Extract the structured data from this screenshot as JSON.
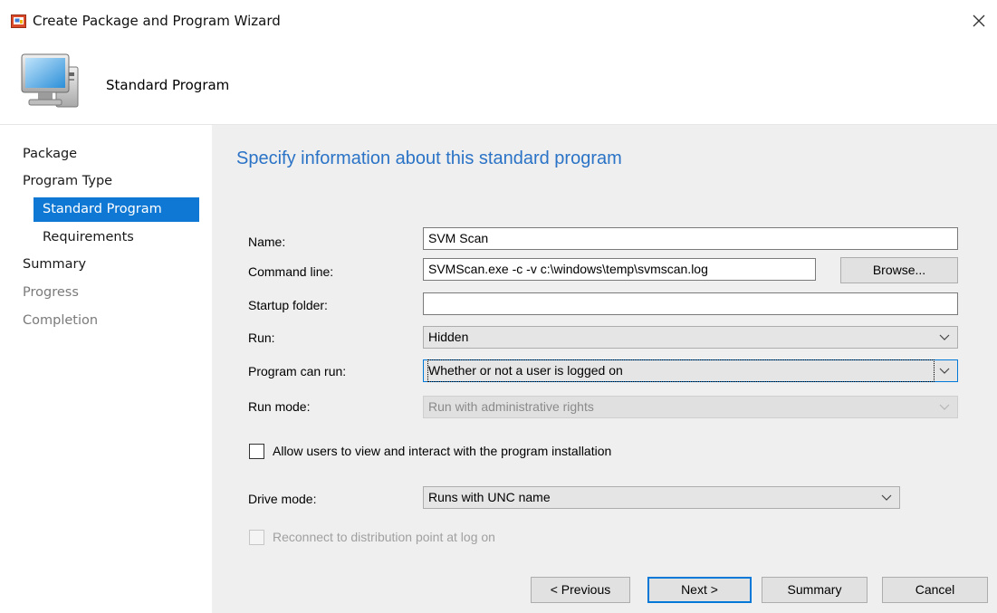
{
  "window": {
    "title": "Create Package and Program Wizard",
    "close_glyph": "×"
  },
  "header": {
    "title": "Standard Program",
    "icon": "computer-monitor-icon"
  },
  "sidebar": {
    "items": [
      {
        "label": "Package",
        "state": "normal"
      },
      {
        "label": "Program Type",
        "state": "normal"
      },
      {
        "label": "Standard Program",
        "state": "active"
      },
      {
        "label": "Requirements",
        "state": "normal"
      },
      {
        "label": "Summary",
        "state": "normal"
      },
      {
        "label": "Progress",
        "state": "dim"
      },
      {
        "label": "Completion",
        "state": "dim"
      }
    ]
  },
  "main": {
    "heading": "Specify information about this standard program",
    "fields": {
      "name": {
        "label": "Name:",
        "value": "SVM Scan"
      },
      "command_line": {
        "label": "Command line:",
        "value": "SVMScan.exe -c -v c:\\windows\\temp\\svmscan.log"
      },
      "browse_label": "Browse...",
      "startup_folder": {
        "label": "Startup folder:",
        "value": ""
      },
      "run": {
        "label": "Run:",
        "value": "Hidden"
      },
      "program_can_run": {
        "label": "Program can run:",
        "value": "Whether or not a user is logged on"
      },
      "run_mode": {
        "label": "Run mode:",
        "value": "Run with administrative rights"
      },
      "allow_users": {
        "label": "Allow users to view and interact with the program installation",
        "checked": false
      },
      "drive_mode": {
        "label": "Drive mode:",
        "value": "Runs with UNC name"
      },
      "reconnect": {
        "label": "Reconnect to distribution point at log on",
        "checked": false,
        "enabled": false
      }
    }
  },
  "buttons": {
    "previous": "< Previous",
    "next": "Next >",
    "summary": "Summary",
    "cancel": "Cancel"
  },
  "colors": {
    "accent": "#0f78d4",
    "heading": "#2a73c6",
    "content_bg": "#efefef"
  }
}
